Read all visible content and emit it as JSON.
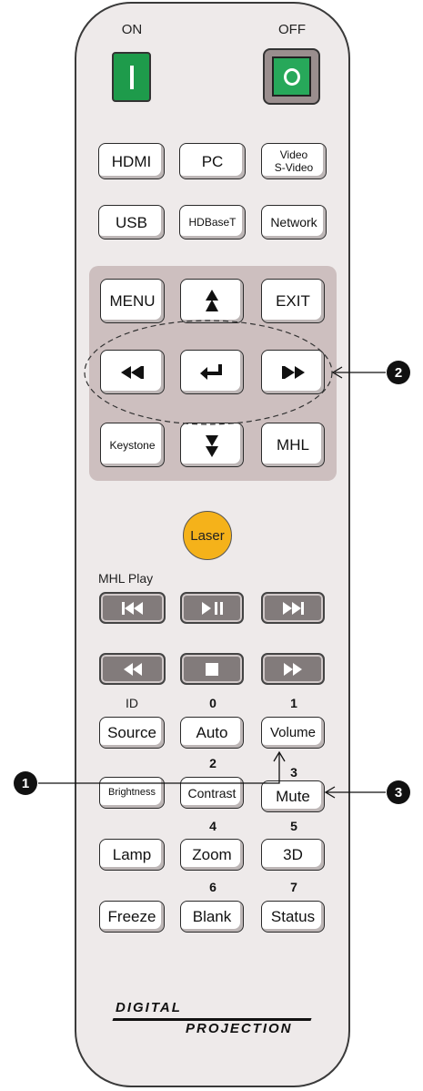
{
  "power": {
    "on_label": "ON",
    "off_label": "OFF",
    "on_symbol": "I",
    "off_symbol": "O",
    "on_color": "#1e9b4b",
    "off_color": "#27a85a"
  },
  "source_row1": [
    "HDMI",
    "PC",
    "Video",
    "S-Video"
  ],
  "source_row2": [
    "USB",
    "HDBaseT",
    "Network"
  ],
  "nav": {
    "menu": "MENU",
    "exit": "EXIT",
    "keystone": "Keystone",
    "mhl": "MHL"
  },
  "laser_label": "Laser",
  "laser_color": "#f5b21a",
  "mhl_play_label": "MHL  Play",
  "function_keys": {
    "id_label": "ID",
    "source": "Source",
    "auto": "Auto",
    "volume": "Volume",
    "brightness": "Brightness",
    "contrast": "Contrast",
    "mute": "Mute",
    "lamp": "Lamp",
    "zoom": "Zoom",
    "three_d": "3D",
    "freeze": "Freeze",
    "blank": "Blank",
    "status": "Status"
  },
  "numbers": {
    "n0": "0",
    "n1": "1",
    "n2": "2",
    "n3": "3",
    "n4": "4",
    "n5": "5",
    "n6": "6",
    "n7": "7"
  },
  "brand": {
    "line1": "DIGITAL",
    "line2": "PROJECTION"
  },
  "callouts": {
    "c1": "1",
    "c2": "2",
    "c3": "3"
  }
}
